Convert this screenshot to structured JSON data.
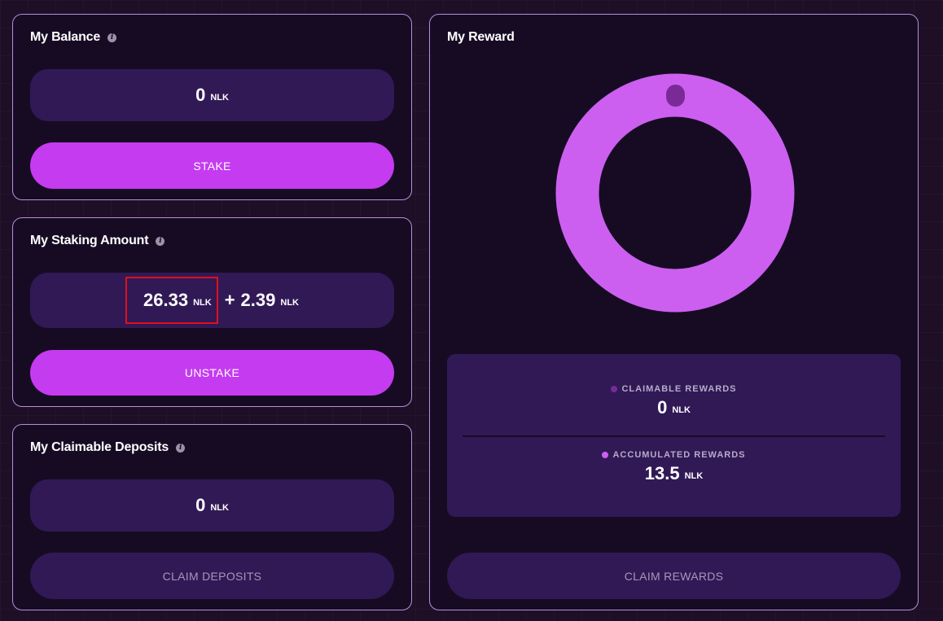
{
  "balance_card": {
    "title": "My Balance",
    "amount": "0",
    "unit": "NLK",
    "button_label": "STAKE"
  },
  "staking_card": {
    "title": "My Staking Amount",
    "amount": "26.33",
    "unit": "NLK",
    "plus": "+",
    "bonus_amount": "2.39",
    "bonus_unit": "NLK",
    "button_label": "UNSTAKE"
  },
  "deposits_card": {
    "title": "My Claimable Deposits",
    "amount": "0",
    "unit": "NLK",
    "button_label": "CLAIM DEPOSITS"
  },
  "reward_card": {
    "title": "My Reward",
    "chart": {
      "type": "donut",
      "segments": [
        {
          "name": "claimable_rewards",
          "value": 0,
          "color": "#7a2a96"
        },
        {
          "name": "accumulated_rewards",
          "value": 13.5,
          "color": "#cc5ff0"
        }
      ]
    },
    "claimable": {
      "label": "CLAIMABLE REWARDS",
      "amount": "0",
      "unit": "NLK",
      "dot_color": "#7a2a96"
    },
    "accumulated": {
      "label": "ACCUMULATED REWARDS",
      "amount": "13.5",
      "unit": "NLK",
      "dot_color": "#cc5ff0"
    },
    "button_label": "CLAIM REWARDS"
  },
  "colors": {
    "accent": "#c53bf0",
    "card_bg": "#170b24",
    "card_border": "#b490d8",
    "panel_bg": "#311956",
    "highlight": "#e0101c"
  },
  "icons": {
    "info": "info-icon"
  }
}
